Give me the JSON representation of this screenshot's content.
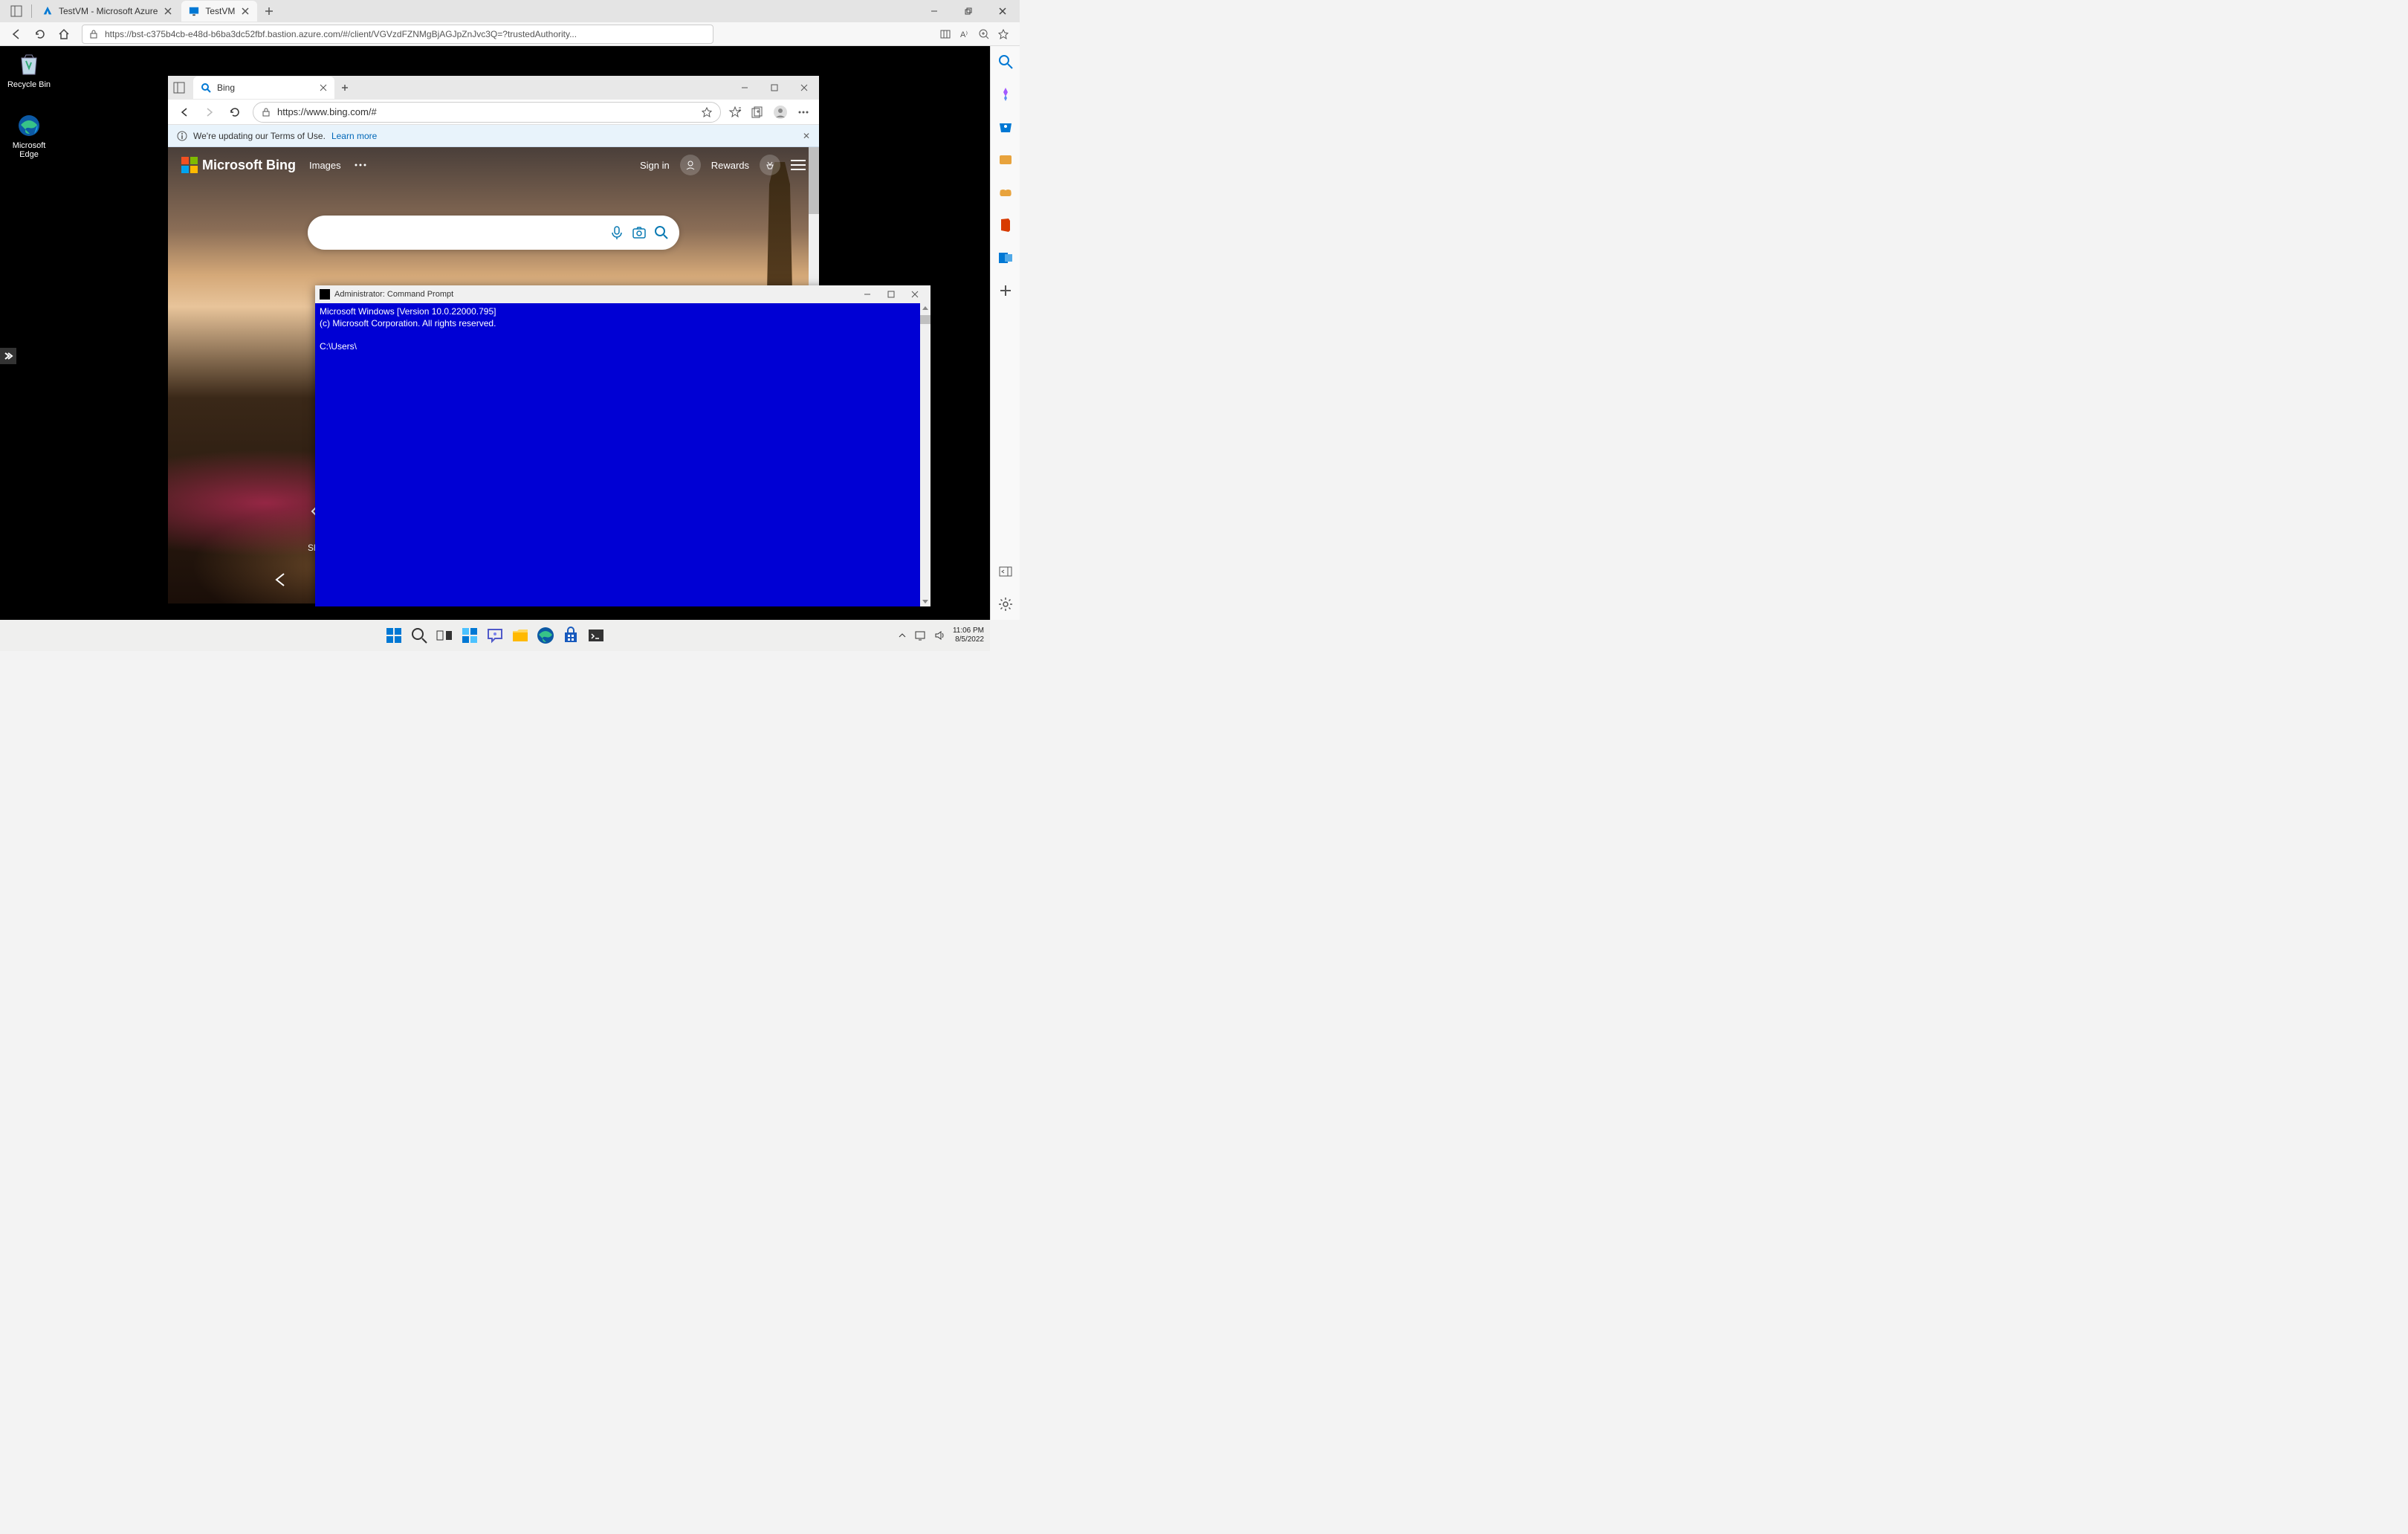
{
  "host": {
    "tabs": [
      {
        "title": "TestVM  - Microsoft Azure",
        "icon": "azure"
      },
      {
        "title": "TestVM",
        "icon": "vm"
      }
    ],
    "url": "https://bst-c375b4cb-e48d-b6ba3dc52fbf.bastion.azure.com/#/client/VGVzdFZNMgBjAGJpZnJvc3Q=?trustedAuthority...",
    "winControls": {
      "min": "—",
      "max": "▢",
      "close": "✕"
    }
  },
  "remote": {
    "desktopIcons": [
      {
        "label": "Recycle Bin"
      },
      {
        "label": "Microsoft Edge"
      }
    ],
    "time": "11:06 PM",
    "date": "8/5/2022"
  },
  "innerEdge": {
    "tab": {
      "title": "Bing"
    },
    "url": "https://www.bing.com/#",
    "banner": {
      "text": "We're updating our Terms of Use.",
      "link": "Learn more"
    }
  },
  "bing": {
    "logo": "Microsoft Bing",
    "imagesLink": "Images",
    "signIn": "Sign in",
    "rewards": "Rewards",
    "carousel": "Sh"
  },
  "cmd": {
    "title": "Administrator: Command Prompt",
    "line1": "Microsoft Windows [Version 10.0.22000.795]",
    "line2": "(c) Microsoft Corporation. All rights reserved.",
    "prompt": "C:\\Users\\"
  }
}
